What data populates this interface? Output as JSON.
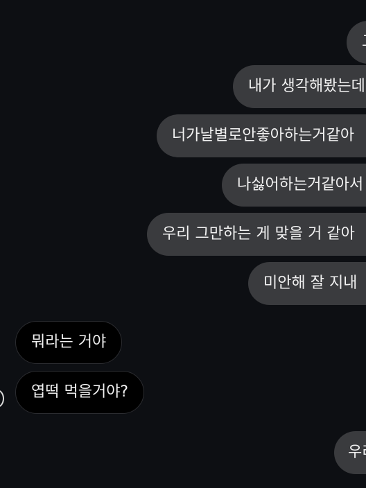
{
  "conversation": {
    "sent_messages": [
      {
        "text": "그"
      },
      {
        "text": "내가 생각해봤는데"
      },
      {
        "text": "너가날별로안좋아하는거같아"
      },
      {
        "text": "나싫어하는거같아서"
      },
      {
        "text": "우리 그만하는 게 맞을 거 같아"
      },
      {
        "text": "미안해 잘 지내"
      },
      {
        "text": "우리"
      }
    ],
    "received_messages": [
      {
        "text": "뭐라는 거야"
      },
      {
        "text": "엽떡 먹을거야?"
      }
    ]
  },
  "colors": {
    "background": "#0d0f13",
    "sent_bubble": "#3a3b3e",
    "received_bubble": "#000000",
    "text": "#f2f2f2"
  }
}
